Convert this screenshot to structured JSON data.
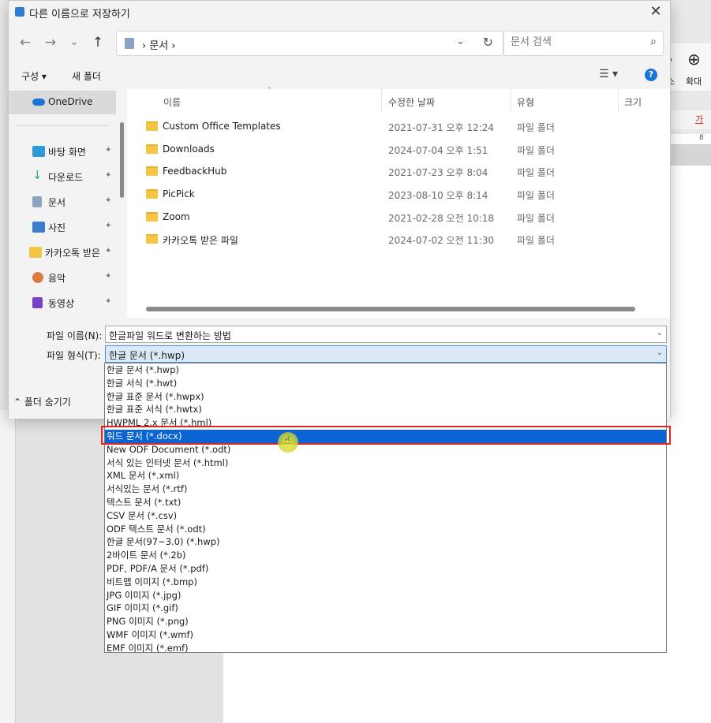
{
  "dialog": {
    "title": "다른 이름으로 저장하기",
    "close": "✕"
  },
  "nav": {
    "back": "←",
    "forward": "→",
    "recent": "⌄",
    "up": "↑",
    "address": "›  문서  ›",
    "address_drop": "⌄",
    "refresh": "↻",
    "search_placeholder": "문서 검색",
    "search_icon": "⌕"
  },
  "commands": {
    "organize": "구성 ▾",
    "new_folder": "새 폴더",
    "view": "☰ ▾",
    "help": "?"
  },
  "navpane": {
    "items": [
      {
        "label": "OneDrive",
        "icon": "cloud-icon",
        "color": "#1a73d6",
        "pinned": false
      },
      {
        "label": "바탕 화면",
        "icon": "desktop-icon",
        "color": "#2a9ad8",
        "pinned": true
      },
      {
        "label": "다운로드",
        "icon": "download-icon",
        "color": "#2bb36b",
        "pinned": true
      },
      {
        "label": "문서",
        "icon": "document-icon",
        "color": "#8aa3c2",
        "pinned": true
      },
      {
        "label": "사진",
        "icon": "picture-icon",
        "color": "#3b7bd0",
        "pinned": true
      },
      {
        "label": "카카오톡 받은",
        "icon": "folder-icon",
        "color": "#f7c544",
        "pinned": true
      },
      {
        "label": "음악",
        "icon": "music-icon",
        "color": "#e07a3c",
        "pinned": true
      },
      {
        "label": "동영상",
        "icon": "video-icon",
        "color": "#7a3fc8",
        "pinned": true
      }
    ],
    "pin": "📌"
  },
  "filelist": {
    "columns": {
      "name": "이름",
      "date": "수정한 날짜",
      "type": "유형",
      "size": "크기"
    },
    "rows": [
      {
        "name": "Custom Office Templates",
        "date": "2021-07-31 오후 12:24",
        "type": "파일 폴더"
      },
      {
        "name": "Downloads",
        "date": "2024-07-04 오후 1:51",
        "type": "파일 폴더"
      },
      {
        "name": "FeedbackHub",
        "date": "2021-07-23 오후 8:04",
        "type": "파일 폴더"
      },
      {
        "name": "PicPick",
        "date": "2023-08-10 오후 8:14",
        "type": "파일 폴더"
      },
      {
        "name": "Zoom",
        "date": "2021-02-28 오전 10:18",
        "type": "파일 폴더"
      },
      {
        "name": "카카오톡 받은 파일",
        "date": "2024-07-02 오전 11:30",
        "type": "파일 폴더"
      }
    ]
  },
  "fields": {
    "filename_label": "파일 이름(N):",
    "filename_value": "한글파일 워드로 변환하는 방법",
    "filetype_label": "파일 형식(T):",
    "filetype_value": "한글 문서 (*.hwp)",
    "chevron": "⌄",
    "hide_folders": "⌃ 폴더 숨기기"
  },
  "filetype_options": [
    "한글 문서 (*.hwp)",
    "한글 서식 (*.hwt)",
    "한글 표준 문서 (*.hwpx)",
    "한글 표준 서식 (*.hwtx)",
    "HWPML 2.x 문서 (*.hml)",
    "워드 문서 (*.docx)",
    "New ODF Document (*.odt)",
    "서식 있는 인터넷 문서 (*.html)",
    "XML 문서 (*.xml)",
    "서식있는 문서 (*.rtf)",
    "텍스트 문서 (*.txt)",
    "CSV 문서 (*.csv)",
    "ODF 텍스트 문서 (*.odt)",
    "한글 문서(97~3.0) (*.hwp)",
    "2바이트 문서 (*.2b)",
    "PDF, PDF/A 문서 (*.pdf)",
    "비트맵 이미지 (*.bmp)",
    "JPG 이미지 (*.jpg)",
    "GIF 이미지 (*.gif)",
    "PNG 이미지 (*.png)",
    "WMF 이미지 (*.wmf)",
    "EMF 이미지 (*.emf)"
  ],
  "selected_option_index": 5,
  "background_app": {
    "zoom_out": "소",
    "zoom_in_label": "확대",
    "zoom_icon": "⊕",
    "char_label": "가",
    "ruler_mark": "8"
  },
  "colors": {
    "accent": "#0a64d4",
    "highlight": "#e02424",
    "folder": "#f7c544"
  }
}
